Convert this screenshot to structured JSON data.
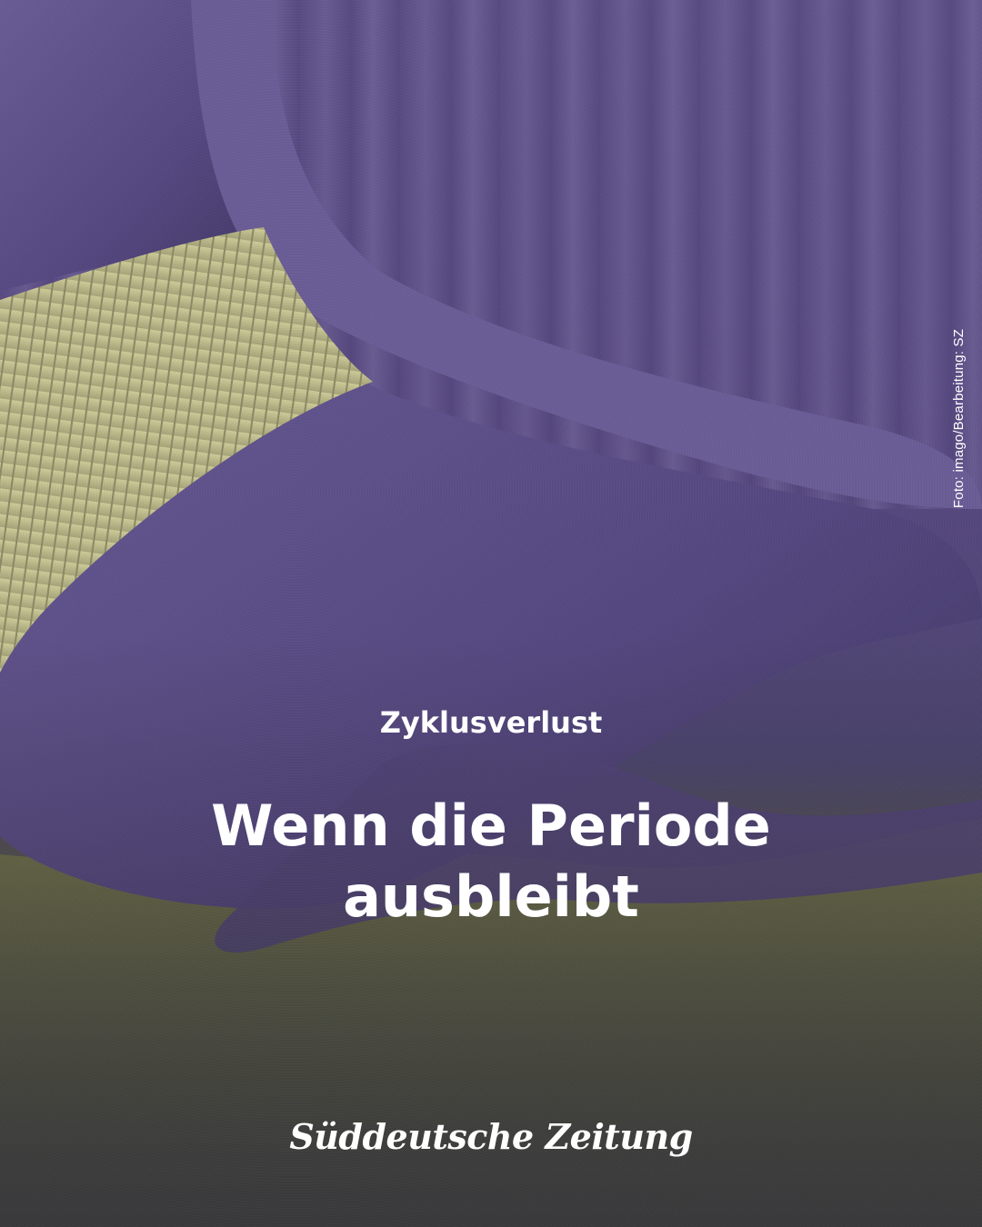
{
  "post": {
    "kicker": "Zyklusverlust",
    "headline": "Wenn die Periode ausbleibt",
    "photo_credit": "Foto: imago/Bearbeitung: SZ",
    "brand_logo_text": "Süddeutsche Zeitung"
  },
  "colors": {
    "duotone_purple": "#5a4d85",
    "duotone_yellow": "#c9cc8a",
    "text": "#ffffff"
  }
}
